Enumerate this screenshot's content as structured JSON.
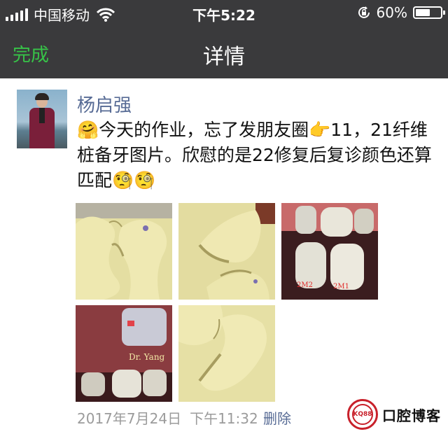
{
  "status_bar": {
    "carrier": "中国移动",
    "time": "下午5:22",
    "battery_percent": "60%",
    "battery_level": 0.6,
    "icons": [
      "signal-icon",
      "wifi-icon",
      "rotation-lock-icon",
      "battery-icon"
    ]
  },
  "nav": {
    "back_label": "完成",
    "title": "详情"
  },
  "post": {
    "author": "杨启强",
    "text": "🤗今天的作业，忘了发朋友圈👉11，21纤维桩备牙图片。欣慰的是22修复后复诊颜色还算匹配🧐🧐",
    "photos": [
      {
        "kind": "dental-model"
      },
      {
        "kind": "dental-model"
      },
      {
        "kind": "teeth-photo",
        "caption_a": "2M2",
        "caption_b": "2M1"
      },
      {
        "kind": "teeth-photo",
        "caption": "Dr. Yang"
      },
      {
        "kind": "dental-model"
      }
    ],
    "date": "2017年7月24日",
    "time": "下午11:32",
    "delete_label": "删除"
  },
  "watermark": {
    "logo_text": "KQ88",
    "brand": "口腔博客"
  },
  "colors": {
    "nav_bg": "#3a3a3c",
    "accent_green": "#37c348",
    "link_blue": "#576b95",
    "meta_gray": "#9b9b9b",
    "brand_red": "#c8202a"
  }
}
